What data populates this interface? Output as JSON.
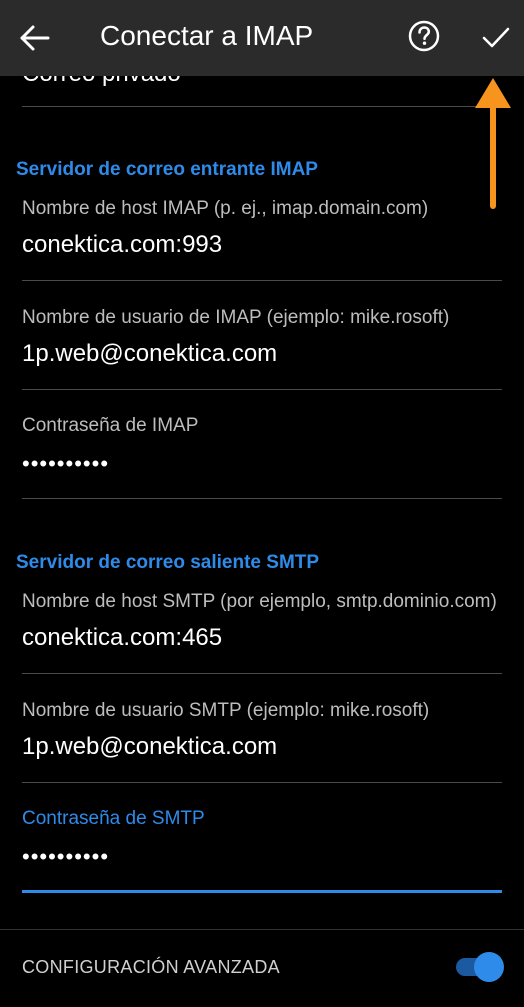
{
  "header": {
    "title": "Conectar a IMAP"
  },
  "previous_field": {
    "value": "Correo privado"
  },
  "incoming": {
    "section_title": "Servidor de correo entrante IMAP",
    "host_label": "Nombre de host IMAP (p. ej., imap.domain.com)",
    "host_value": "conektica.com:993",
    "user_label": "Nombre de usuario de IMAP (ejemplo: mike.rosoft)",
    "user_value": "1p.web@conektica.com",
    "password_label": "Contraseña de IMAP",
    "password_value": "••••••••••"
  },
  "outgoing": {
    "section_title": "Servidor de correo saliente SMTP",
    "host_label": "Nombre de host SMTP (por ejemplo, smtp.dominio.com)",
    "host_value": "conektica.com:465",
    "user_label": "Nombre de usuario SMTP (ejemplo: mike.rosoft)",
    "user_value": "1p.web@conektica.com",
    "password_label": "Contraseña de SMTP",
    "password_value": "••••••••••"
  },
  "advanced": {
    "label": "CONFIGURACIÓN AVANZADA",
    "toggle_on": true
  },
  "icons": {
    "back": "arrow-left-icon",
    "help": "help-circle-icon",
    "confirm": "checkmark-icon",
    "annotation": "arrow-up-icon"
  },
  "colors": {
    "accent": "#2e8bea",
    "appbar": "#2b2b2b",
    "background": "#000000",
    "annotation": "#f7941d"
  }
}
